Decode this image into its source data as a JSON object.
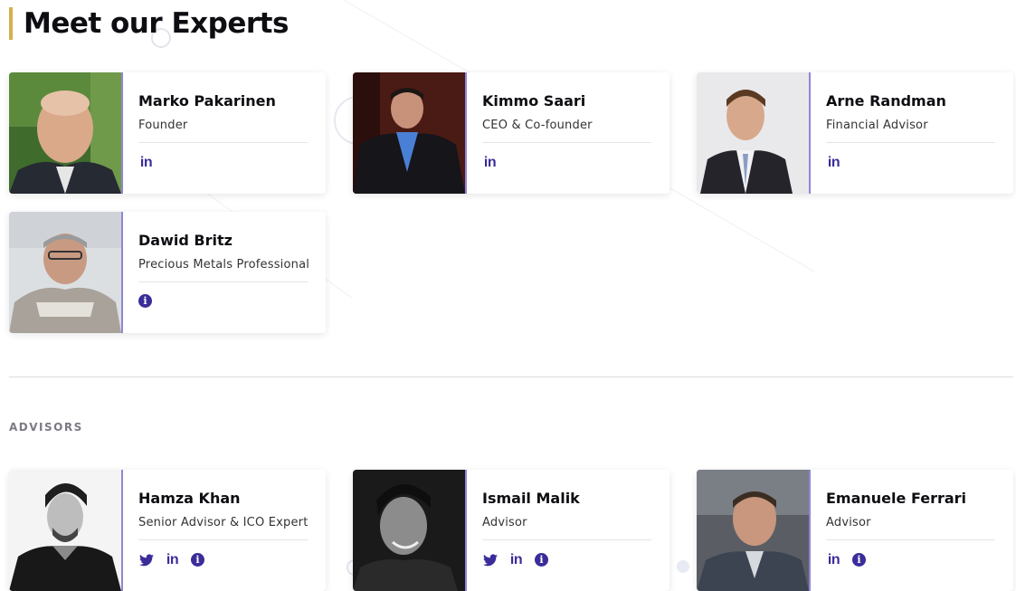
{
  "page": {
    "heading": "Meet our Experts",
    "accent_color": "#d6b04d",
    "icon_color": "#3a2d9a"
  },
  "team": [
    {
      "name": "Marko Pakarinen",
      "role": "Founder",
      "links": [
        "linkedin-icon"
      ]
    },
    {
      "name": "Kimmo Saari",
      "role": "CEO & Co-founder",
      "links": [
        "linkedin-icon"
      ]
    },
    {
      "name": "Arne Randman",
      "role": "Financial Advisor",
      "links": [
        "linkedin-icon"
      ]
    },
    {
      "name": "Dawid Britz",
      "role": "Precious Metals Professional",
      "links": [
        "info-icon"
      ]
    }
  ],
  "advisors_section": {
    "label": "ADVISORS"
  },
  "advisors": [
    {
      "name": "Hamza Khan",
      "role": "Senior Advisor & ICO Expert",
      "links": [
        "twitter-icon",
        "linkedin-icon",
        "info-icon"
      ]
    },
    {
      "name": "Ismail Malik",
      "role": "Advisor",
      "links": [
        "twitter-icon",
        "linkedin-icon",
        "info-icon"
      ]
    },
    {
      "name": "Emanuele Ferrari",
      "role": "Advisor",
      "links": [
        "linkedin-icon",
        "info-icon"
      ]
    }
  ]
}
